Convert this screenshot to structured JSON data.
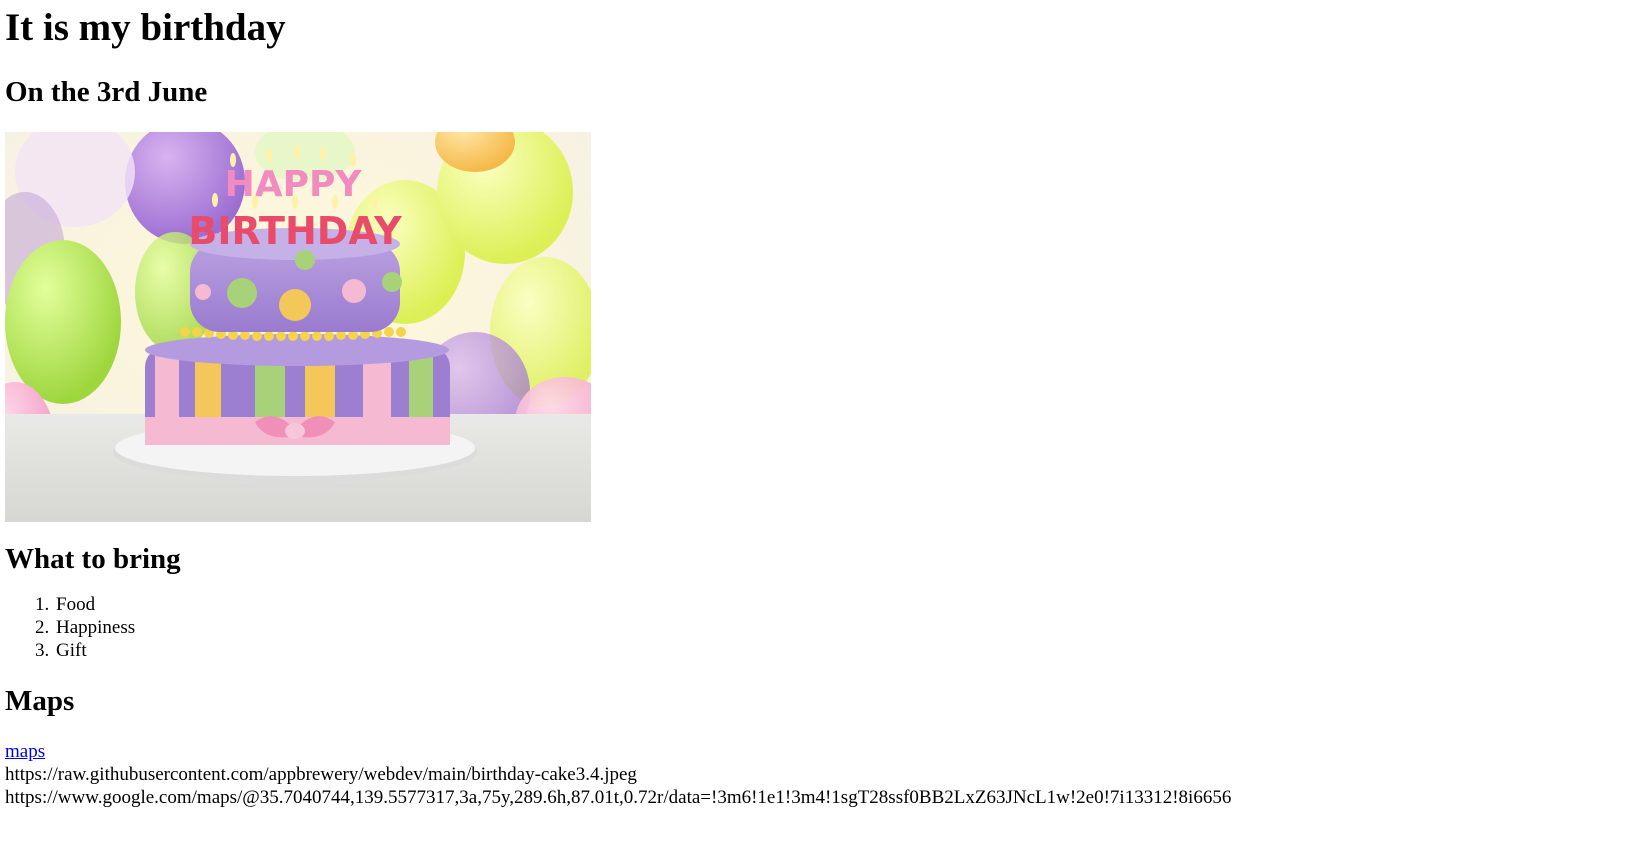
{
  "page": {
    "title": "It is my birthday",
    "date_heading": "On the 3rd June",
    "image": {
      "alt": "birthday cake",
      "cake_text_top": "HAPPY",
      "cake_text_bottom": "BIRTHDAY",
      "colors": {
        "cake_purple": "#a98ad6",
        "ribbon_pink": "#f6b9d2",
        "stripe_yellow": "#f3c75a",
        "stripe_green": "#a8d27a",
        "plate": "#f2f2f2"
      }
    },
    "bring_heading": "What to bring",
    "bring_items": [
      "Food",
      "Happiness",
      "Gift"
    ],
    "maps_heading": "Maps",
    "maps_link_label": "maps",
    "image_url_text": "https://raw.githubusercontent.com/appbrewery/webdev/main/birthday-cake3.4.jpeg",
    "maps_url_text": "https://www.google.com/maps/@35.7040744,139.5577317,3a,75y,289.6h,87.01t,0.72r/data=!3m6!1e1!3m4!1sgT28ssf0BB2LxZ63JNcL1w!2e0!7i13312!8i6656"
  }
}
